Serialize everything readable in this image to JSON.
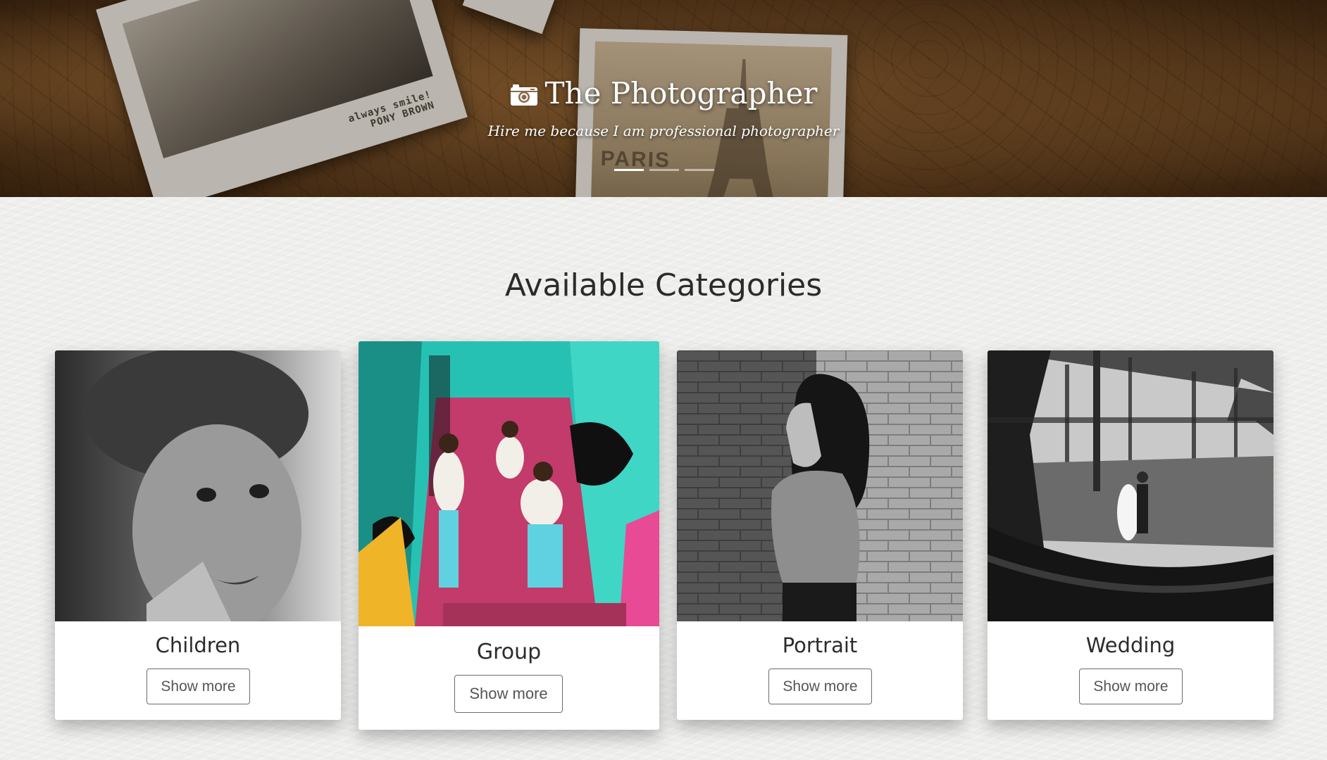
{
  "hero": {
    "title": "The Photographer",
    "subtitle": "Hire me because I am professional photographer",
    "icon": "camera-icon",
    "polaroid_caption_1": "always smile!",
    "polaroid_caption_2": "PONY BROWN",
    "polaroid_caption_3": "PARIS",
    "slides": 3,
    "active_slide": 1
  },
  "categories_section": {
    "title": "Available Categories",
    "items": [
      {
        "label": "Children",
        "button": "Show more"
      },
      {
        "label": "Group",
        "button": "Show more"
      },
      {
        "label": "Portrait",
        "button": "Show more"
      },
      {
        "label": "Wedding",
        "button": "Show more"
      }
    ]
  }
}
